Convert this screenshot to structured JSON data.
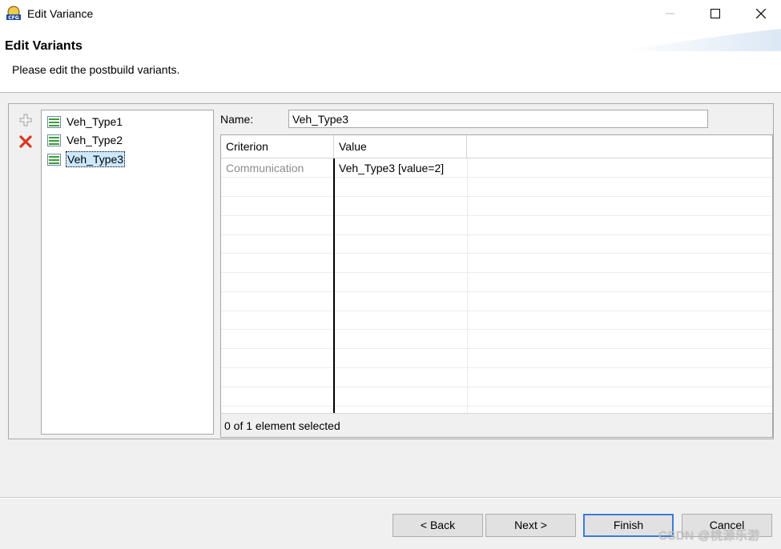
{
  "window": {
    "title": "Edit Variance",
    "app_icon_text": "CFG"
  },
  "header": {
    "title": "Edit Variants",
    "description": "Please edit the postbuild variants."
  },
  "toolbar": {
    "add_icon": "plus-icon",
    "remove_icon": "red-x-icon"
  },
  "variants": [
    {
      "label": "Veh_Type1",
      "selected": false
    },
    {
      "label": "Veh_Type2",
      "selected": false
    },
    {
      "label": "Veh_Type3",
      "selected": true
    }
  ],
  "editor": {
    "name_label": "Name:",
    "name_value": "Veh_Type3"
  },
  "table": {
    "columns": [
      "Criterion",
      "Value"
    ],
    "rows": [
      {
        "criterion": "Communication",
        "value": "Veh_Type3 [value=2]"
      }
    ],
    "status": "0 of 1 element selected"
  },
  "buttons": {
    "back": "< Back",
    "next": "Next >",
    "finish": "Finish",
    "cancel": "Cancel"
  },
  "watermark": "CSDN @桃源乐游",
  "colors": {
    "selection": "#cce8ff",
    "finish_border": "#3a7dd7",
    "criterion_text": "#8c8c8c"
  }
}
